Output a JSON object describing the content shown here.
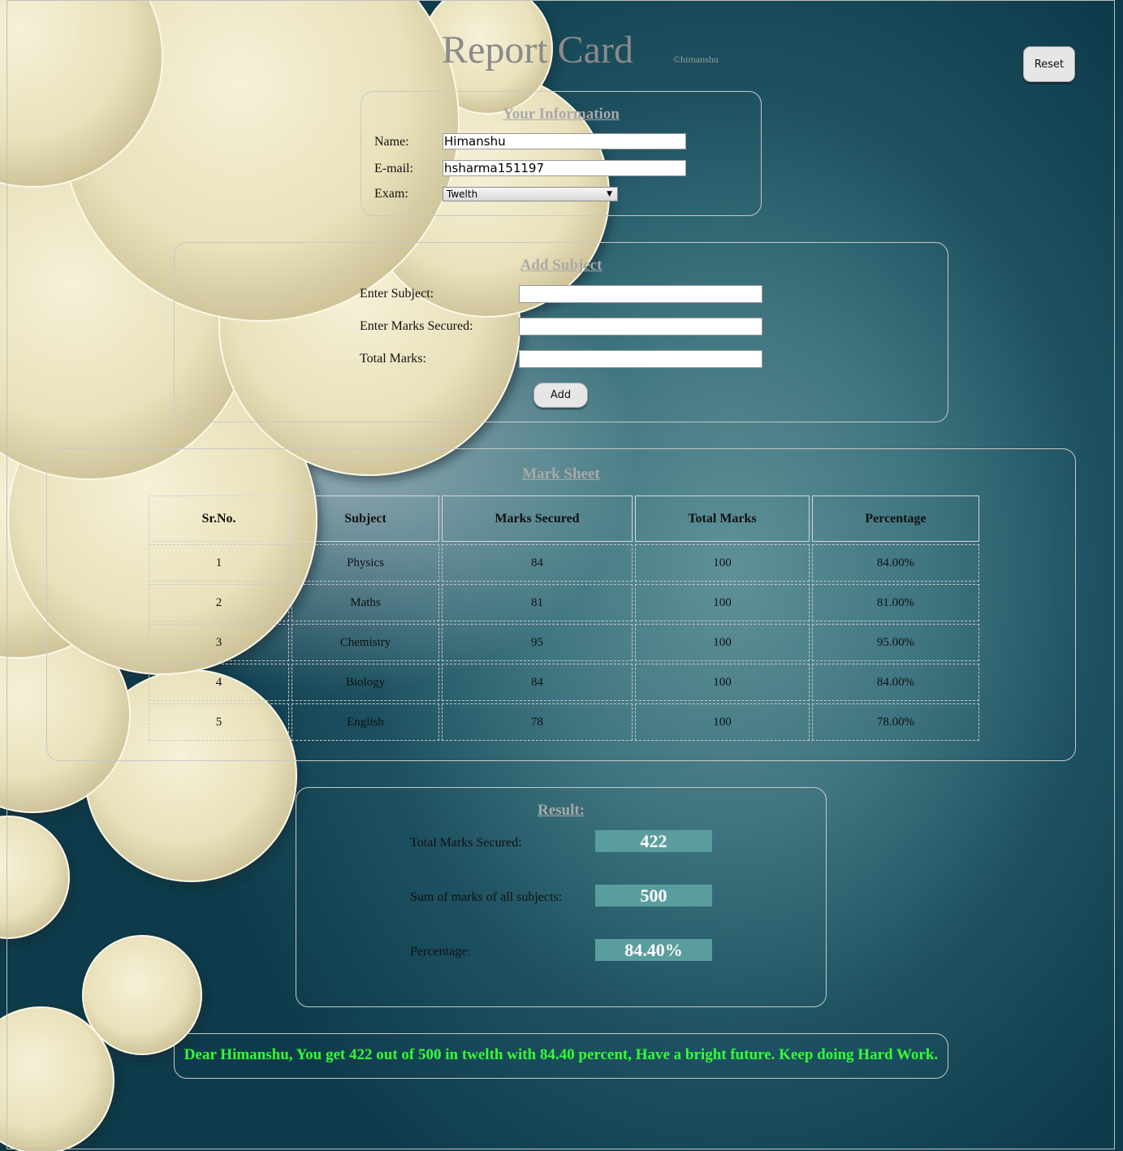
{
  "header": {
    "title": "Report Card",
    "credit": "©himanshu",
    "reset_label": "Reset"
  },
  "info": {
    "legend": "Your Information",
    "name_label": "Name:",
    "name_value": "Himanshu",
    "email_label": "E-mail:",
    "email_value": "hsharma151197",
    "exam_label": "Exam:",
    "exam_value": "Twelth"
  },
  "add_subject": {
    "legend": "Add Subject",
    "subject_label": "Enter Subject:",
    "marks_label": "Enter Marks Secured:",
    "total_label": "Total Marks:",
    "add_label": "Add"
  },
  "mark_sheet": {
    "legend": "Mark Sheet",
    "columns": [
      "Sr.No.",
      "Subject",
      "Marks Secured",
      "Total Marks",
      "Percentage"
    ],
    "rows": [
      [
        "1",
        "Physics",
        "84",
        "100",
        "84.00%"
      ],
      [
        "2",
        "Maths",
        "81",
        "100",
        "81.00%"
      ],
      [
        "3",
        "Chemistry",
        "95",
        "100",
        "95.00%"
      ],
      [
        "4",
        "Biology",
        "84",
        "100",
        "84.00%"
      ],
      [
        "5",
        "English",
        "78",
        "100",
        "78.00%"
      ]
    ]
  },
  "result": {
    "legend": "Result:",
    "total_secured_label": "Total Marks Secured:",
    "total_secured_value": "422",
    "sum_label": "Sum of marks of all subjects:",
    "sum_value": "500",
    "percentage_label": "Percentage:",
    "percentage_value": "84.40%"
  },
  "message": "Dear Himanshu, You get 422 out of 500 in twelth with 84.40 percent, Have a bright future. Keep doing Hard Work.",
  "colors": {
    "background_teal": "#1d5161",
    "result_box": "#5a9d9e",
    "message_green": "#33ff33",
    "legend_gray": "#a9a9a9"
  }
}
